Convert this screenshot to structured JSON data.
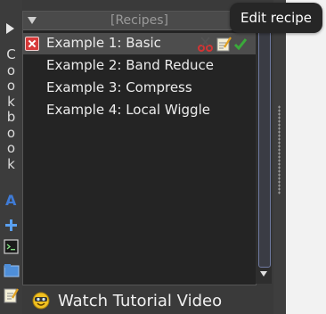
{
  "sidebar": {
    "label": "Cookbook"
  },
  "panel": {
    "title": "[Recipes]",
    "items": [
      {
        "label": "Example 1: Basic",
        "selected": true
      },
      {
        "label": "Example 2: Band Reduce",
        "selected": false
      },
      {
        "label": "Example 3: Compress",
        "selected": false
      },
      {
        "label": "Example 4: Local Wiggle",
        "selected": false
      }
    ]
  },
  "tooltip": {
    "text": "Edit recipe"
  },
  "footer": {
    "tutorial_label": "Watch Tutorial Video"
  },
  "colors": {
    "panel_bg": "#242424",
    "selected_row": "#4d4d4d",
    "scroll_thumb_border": "#6f7aa0",
    "delete_red": "#d83a3a",
    "tooltip_bg": "#262626"
  }
}
